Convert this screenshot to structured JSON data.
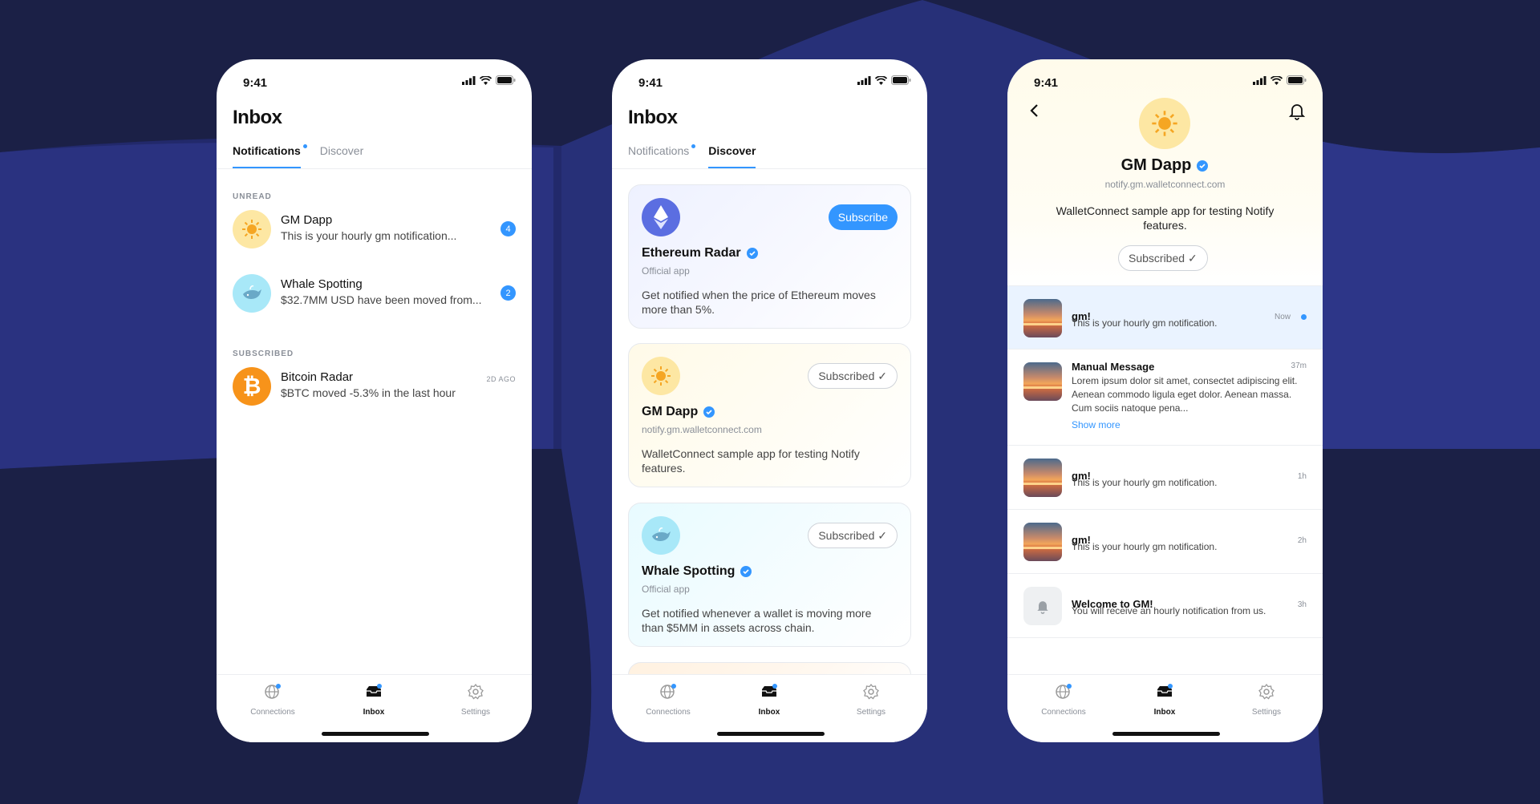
{
  "status": {
    "time": "9:41"
  },
  "nav": {
    "connections": "Connections",
    "inbox": "Inbox",
    "settings": "Settings"
  },
  "colors": {
    "accent": "#3396ff",
    "background": "#1b2046"
  },
  "screen1": {
    "title": "Inbox",
    "tabs": [
      "Notifications",
      "Discover"
    ],
    "unread_label": "UNREAD",
    "subscribed_label": "SUBSCRIBED",
    "unread": [
      {
        "name": "GM Dapp",
        "message": "This is your hourly gm notification...",
        "badge": "4",
        "icon": "sun-icon"
      },
      {
        "name": "Whale Spotting",
        "message": "$32.7MM USD have been moved from...",
        "badge": "2",
        "icon": "whale-icon"
      }
    ],
    "subscribed": [
      {
        "name": "Bitcoin Radar",
        "message": "$BTC moved -5.3% in the last hour",
        "ago": "2D AGO",
        "icon": "bitcoin-icon"
      }
    ]
  },
  "screen2": {
    "title": "Inbox",
    "tabs": [
      "Notifications",
      "Discover"
    ],
    "cards": [
      {
        "name": "Ethereum Radar",
        "sub": "Official app",
        "desc": "Get notified when the price of Ethereum moves more than 5%.",
        "button": "Subscribe",
        "icon": "ethereum-icon"
      },
      {
        "name": "GM Dapp",
        "sub": "notify.gm.walletconnect.com",
        "desc": "WalletConnect sample app for testing Notify features.",
        "button": "Subscribed",
        "icon": "sun-icon"
      },
      {
        "name": "Whale Spotting",
        "sub": "Official app",
        "desc": "Get notified whenever a wallet is moving more than $5MM in assets across chain.",
        "button": "Subscribed",
        "icon": "whale-icon"
      }
    ]
  },
  "screen3": {
    "app_name": "GM Dapp",
    "url": "notify.gm.walletconnect.com",
    "desc": "WalletConnect sample app for testing Notify features.",
    "button": "Subscribed",
    "notifications": [
      {
        "title": "gm!",
        "body": "This is your hourly gm notification.",
        "time": "Now"
      },
      {
        "title": "Manual Message",
        "body": "Lorem ipsum dolor sit amet, consectet adipiscing elit. Aenean commodo ligula eget dolor. Aenean massa. Cum sociis natoque pena...",
        "time": "37m",
        "more": "Show more"
      },
      {
        "title": "gm!",
        "body": "This is your hourly gm notification.",
        "time": "1h"
      },
      {
        "title": "gm!",
        "body": "This is your hourly gm notification.",
        "time": "2h"
      },
      {
        "title": "Welcome to GM!",
        "body": "You will receive an hourly notification from us.",
        "time": "3h"
      }
    ]
  }
}
